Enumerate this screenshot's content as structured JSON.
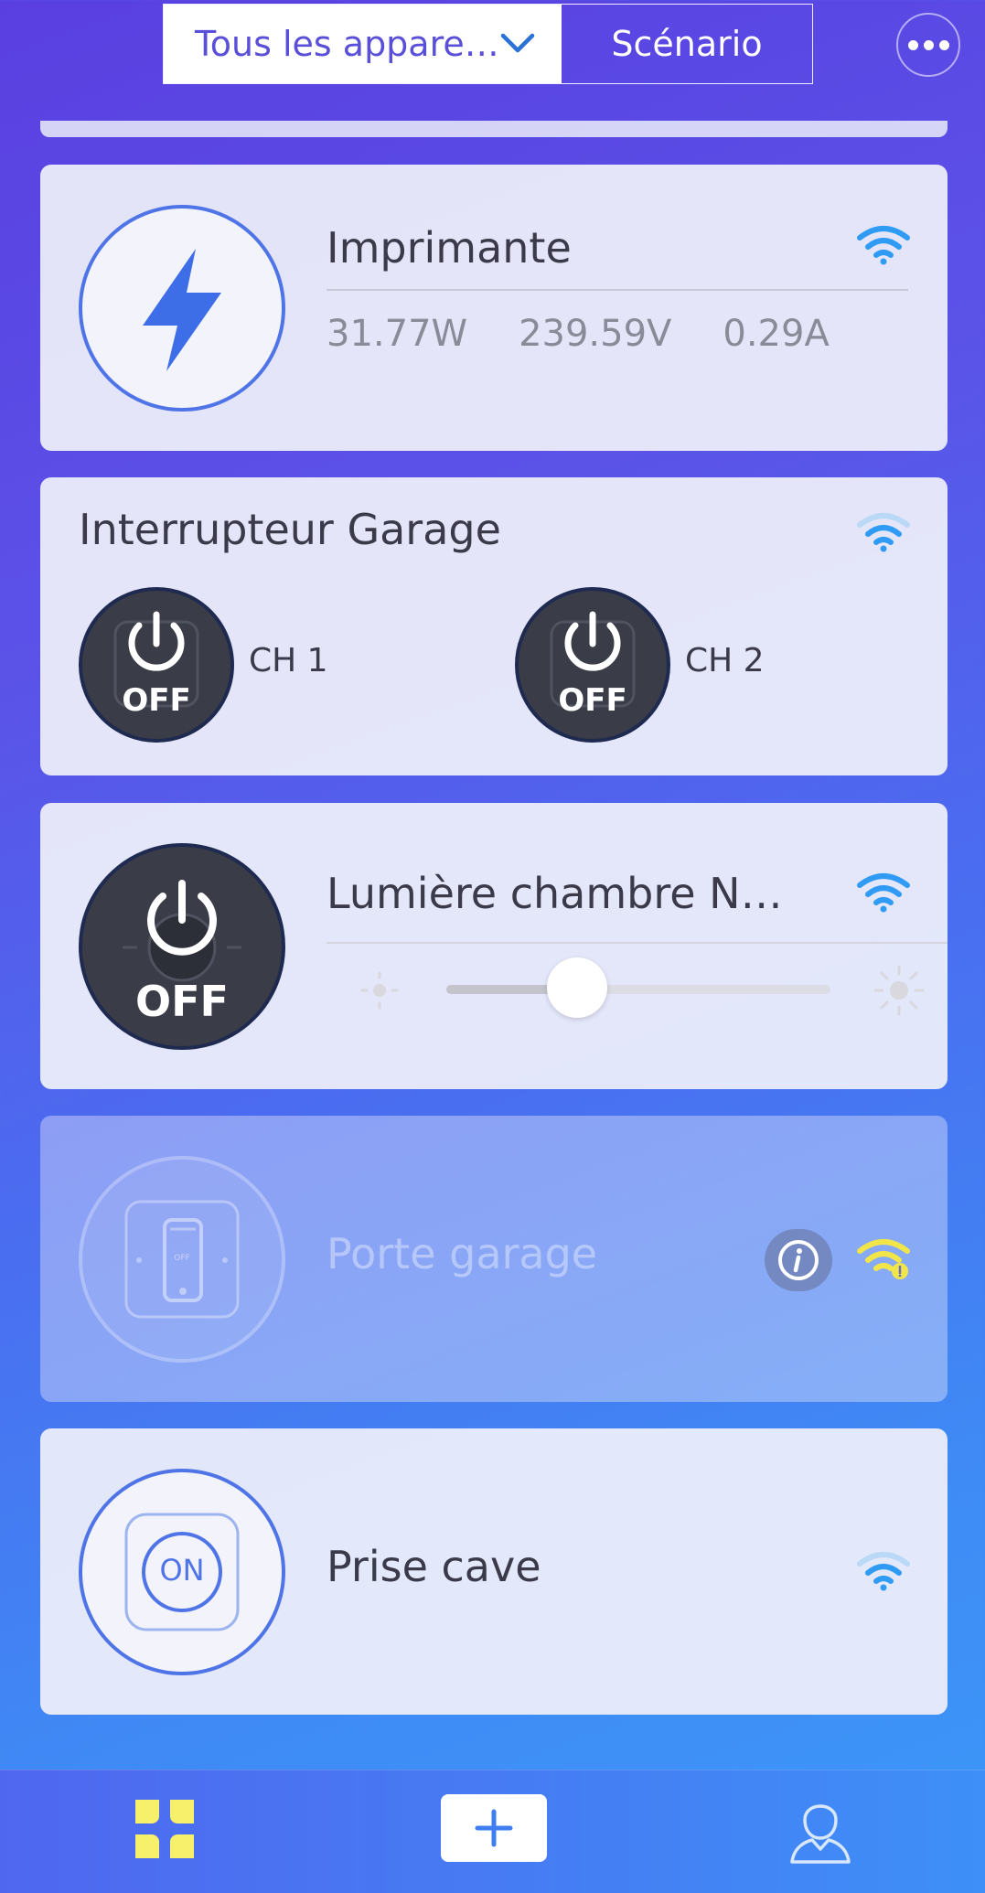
{
  "header": {
    "filter_label": "Tous les appare…",
    "scenario_label": "Scénario"
  },
  "devices": [
    {
      "name": "Imprimante",
      "power": "31.77W",
      "voltage": "239.59V",
      "current": "0.29A"
    },
    {
      "name": "Interrupteur Garage",
      "channels": [
        {
          "label": "CH 1",
          "state": "OFF"
        },
        {
          "label": "CH 2",
          "state": "OFF"
        }
      ]
    },
    {
      "name": "Lumière chambre N…",
      "state": "OFF",
      "brightness": 0.34
    },
    {
      "name": "Porte garage",
      "offline": true,
      "switch_text": "OFF"
    },
    {
      "name": "Prise cave",
      "state": "ON"
    }
  ],
  "colors": {
    "accent": "#4f74e8",
    "wifi": "#2f9bf4",
    "wifi_warning": "#f2e54a",
    "dark_button": "#3a3c47",
    "tab_active": "#f7f06a"
  },
  "icons": {
    "imprimante": "lightning-bolt-icon",
    "tab_devices": "devices-grid-icon",
    "tab_add": "plus-icon",
    "tab_profile": "user-icon"
  }
}
